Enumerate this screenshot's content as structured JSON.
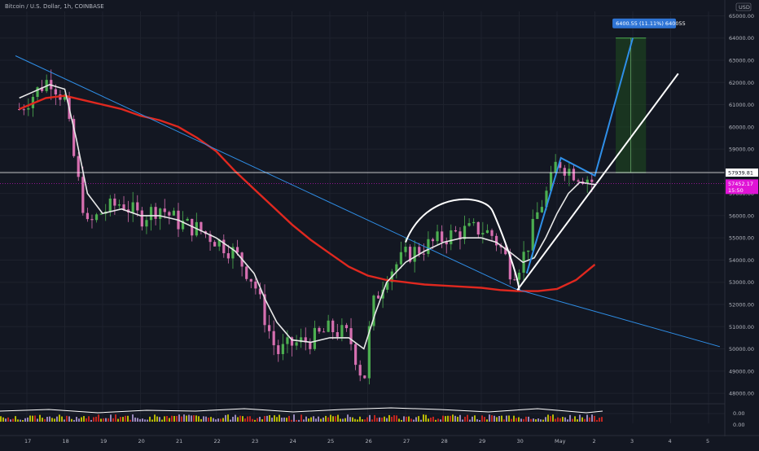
{
  "header": {
    "title": "Bitcoin / U.S. Dollar, 1h, COINBASE"
  },
  "colors": {
    "background": "#131722",
    "up_candle": "#4caf50",
    "down_candle": "#d66fb0",
    "ma_long": "#e0281f",
    "ma_short": "#e8e8e8",
    "trendline": "#2f8fe8",
    "channel_line": "#ffffff",
    "price_line": "#ffffff",
    "current_price_tag": "#e014d6",
    "target_tag": "#2f75d6",
    "target_zone": "#1f4d1f"
  },
  "chart_data": {
    "type": "line",
    "title": "Bitcoin / U.S. Dollar, 1h, COINBASE",
    "xlabel": "",
    "ylabel": "",
    "x_ticks": [
      "17",
      "18",
      "19",
      "20",
      "21",
      "22",
      "23",
      "24",
      "25",
      "26",
      "27",
      "28",
      "29",
      "30",
      "May",
      "2",
      "3",
      "4",
      "5"
    ],
    "y_ticks": [
      "48000.00",
      "49000.00",
      "50000.00",
      "51000.00",
      "52000.00",
      "53000.00",
      "54000.00",
      "55000.00",
      "56000.00",
      "57000.00",
      "58000.00",
      "59000.00",
      "60000.00",
      "61000.00",
      "62000.00",
      "63000.00",
      "64000.00",
      "65000.00"
    ],
    "ylim": [
      47600,
      65200
    ],
    "currency_label": "USD",
    "grid": true,
    "series": [
      {
        "style": "price",
        "x": [
          16.8,
          17.2,
          17.6,
          18.0,
          18.3,
          18.6,
          19.0,
          19.5,
          20.0,
          20.5,
          21.0,
          21.5,
          22.0,
          22.5,
          23.0,
          23.3,
          23.6,
          24.0,
          24.5,
          25.0,
          25.5,
          25.9,
          26.1,
          26.5,
          27.0,
          27.5,
          28.0,
          28.5,
          29.0,
          29.3,
          29.6,
          29.8,
          30.0,
          30.2,
          30.5,
          30.8,
          31.0,
          31.2,
          31.5,
          31.8,
          32.0
        ],
        "y": [
          60800,
          61500,
          62200,
          61200,
          58000,
          55500,
          56200,
          56600,
          55900,
          56400,
          55700,
          55400,
          54900,
          54300,
          53000,
          51300,
          49800,
          50200,
          50400,
          50900,
          50600,
          48500,
          51800,
          53400,
          54200,
          54600,
          55000,
          55300,
          55400,
          55100,
          54300,
          53400,
          53800,
          54500,
          56200,
          57300,
          58500,
          58200,
          57900,
          57700,
          57452
        ]
      },
      {
        "style": "ma_short",
        "x": [
          16.8,
          17.2,
          17.6,
          18.0,
          18.3,
          18.6,
          19.0,
          19.5,
          20.0,
          20.5,
          21.0,
          21.5,
          22.0,
          22.5,
          23.0,
          23.3,
          23.6,
          24.0,
          24.5,
          25.0,
          25.5,
          25.9,
          26.2,
          26.5,
          27.0,
          27.5,
          28.0,
          28.5,
          29.0,
          29.4,
          29.8,
          30.1,
          30.4,
          30.7,
          31.0,
          31.3,
          31.6,
          32.0
        ],
        "y": [
          61300,
          61600,
          61900,
          61700,
          59500,
          57000,
          56100,
          56300,
          56000,
          56000,
          55800,
          55400,
          55000,
          54400,
          53400,
          52200,
          51200,
          50400,
          50300,
          50500,
          50500,
          50000,
          51600,
          53000,
          53900,
          54400,
          54800,
          55000,
          55000,
          54800,
          54300,
          53900,
          54100,
          55000,
          56100,
          57000,
          57500,
          57400
        ]
      },
      {
        "style": "ma_long",
        "x": [
          16.8,
          17.5,
          18.0,
          18.5,
          19.0,
          19.5,
          20.0,
          20.5,
          21.0,
          21.5,
          22.0,
          22.5,
          23.0,
          23.5,
          24.0,
          24.5,
          25.0,
          25.5,
          26.0,
          26.5,
          27.0,
          27.5,
          28.0,
          28.5,
          29.0,
          29.5,
          30.0,
          30.5,
          31.0,
          31.5,
          32.0
        ],
        "y": [
          60800,
          61300,
          61400,
          61200,
          61000,
          60800,
          60500,
          60300,
          60000,
          59500,
          58900,
          58000,
          57200,
          56400,
          55600,
          54900,
          54300,
          53700,
          53300,
          53100,
          53000,
          52900,
          52850,
          52800,
          52750,
          52650,
          52600,
          52600,
          52700,
          53100,
          53800
        ]
      },
      {
        "style": "trendline",
        "x": [
          16.7,
          29.9,
          35.3
        ],
        "y": [
          63200,
          52700,
          50100
        ]
      }
    ],
    "drawings": {
      "channel_lower": {
        "x": [
          29.95,
          34.2
        ],
        "y": [
          52650,
          62400
        ]
      },
      "channel_upper_blue": {
        "x": [
          30.2,
          31.1,
          32.0,
          33.0
        ],
        "y": [
          53400,
          58600,
          57800,
          64000
        ]
      },
      "cup_arc_lows": {
        "x": [
          27.0,
          28.2,
          29.3,
          30.0
        ],
        "y": [
          54800,
          56500,
          56200,
          52650
        ]
      },
      "horizontal_line": 57939.81,
      "target": {
        "label": "6400.55 (11.11%) 640055",
        "from": 57939.81,
        "to": 64000,
        "x_start": 32.55,
        "x_end": 33.35
      }
    },
    "price_labels": {
      "line_price": "57939.81",
      "current_price": "57452.17",
      "countdown": "15:50"
    },
    "indicator_ticks": [
      "0.00",
      "0.00"
    ]
  }
}
